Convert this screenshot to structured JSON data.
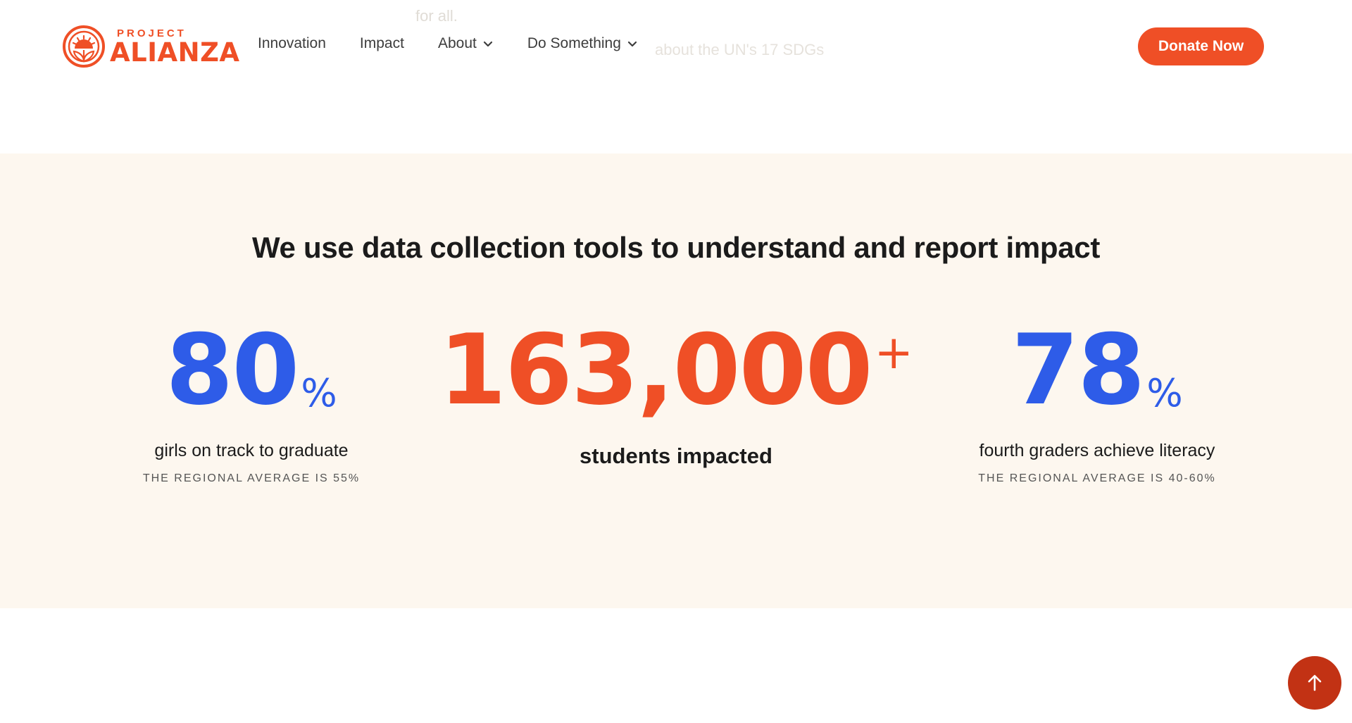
{
  "background_text": {
    "line": "for all.",
    "link": "about the UN's 17 SDGs"
  },
  "header": {
    "logo": {
      "small": "PROJECT",
      "big": "ALIANZA",
      "icon": "alianza-sun-logo-icon"
    },
    "nav": [
      {
        "label": "Innovation",
        "has_dropdown": false
      },
      {
        "label": "Impact",
        "has_dropdown": false
      },
      {
        "label": "About",
        "has_dropdown": true
      },
      {
        "label": "Do Something",
        "has_dropdown": true
      }
    ],
    "donate_label": "Donate Now"
  },
  "stats": {
    "title": "We use data collection tools to understand and report impact",
    "items": [
      {
        "value": "80",
        "unit": "%",
        "label": "girls on track to graduate",
        "sub": "THE REGIONAL AVERAGE IS 55%",
        "color": "#2e5ce8"
      },
      {
        "value": "163,000",
        "unit": "+",
        "label": "students impacted",
        "sub": "",
        "color": "#ef4f26"
      },
      {
        "value": "78",
        "unit": "%",
        "label": "fourth graders achieve literacy",
        "sub": "THE REGIONAL AVERAGE IS 40-60%",
        "color": "#2e5ce8"
      }
    ]
  },
  "scroll_top": {
    "icon": "arrow-up-icon"
  },
  "colors": {
    "brand_orange": "#ef4f26",
    "stat_blue": "#2e5ce8",
    "band_background": "#fdf7ef",
    "scroll_button": "#c23214"
  }
}
